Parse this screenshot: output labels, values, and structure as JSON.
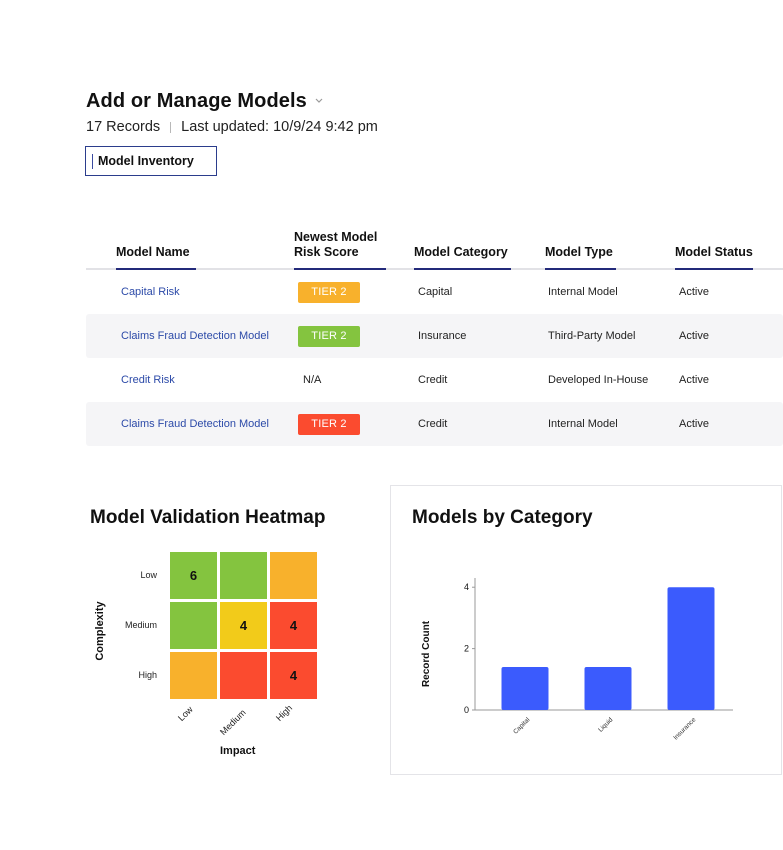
{
  "header": {
    "title": "Add or Manage Models",
    "title_icon": "chevron-down-icon",
    "records": "17 Records",
    "last_updated": "Last updated: 10/9/24 9:42 pm"
  },
  "search": {
    "value": "Model Inventory"
  },
  "table": {
    "columns": [
      {
        "label": "Model Name"
      },
      {
        "label": "Newest Model\nRisk Score"
      },
      {
        "label": "Model Category"
      },
      {
        "label": "Model Type"
      },
      {
        "label": "Model Status"
      }
    ],
    "rows": [
      {
        "name": "Capital Risk",
        "score": "TIER 2",
        "score_color": "#f8b12c",
        "category": "Capital",
        "type": "Internal Model",
        "status": "Active"
      },
      {
        "name": "Claims Fraud Detection Model",
        "score": "TIER 2",
        "score_color": "#84c43f",
        "category": "Insurance",
        "type": "Third-Party Model",
        "status": "Active"
      },
      {
        "name": "Credit Risk",
        "score": "N/A",
        "score_color": null,
        "category": "Credit",
        "type": "Developed In-House",
        "status": "Active"
      },
      {
        "name": "Claims Fraud Detection Model",
        "score": "TIER 2",
        "score_color": "#fb4b2f",
        "category": "Credit",
        "type": "Internal Model",
        "status": "Active"
      }
    ]
  },
  "heatmap": {
    "title": "Model Validation Heatmap",
    "y_axis_title": "Complexity",
    "x_axis_title": "Impact",
    "y_labels": [
      "Low",
      "Medium",
      "High"
    ],
    "x_labels": [
      "Low",
      "Medium",
      "High"
    ],
    "cells": [
      [
        {
          "value": "6",
          "color": "#84c43f"
        },
        {
          "value": "",
          "color": "#84c43f"
        },
        {
          "value": "",
          "color": "#f8b12c"
        }
      ],
      [
        {
          "value": "",
          "color": "#84c43f"
        },
        {
          "value": "4",
          "color": "#f2cb1a"
        },
        {
          "value": "4",
          "color": "#fb4b2f"
        }
      ],
      [
        {
          "value": "",
          "color": "#f8b12c"
        },
        {
          "value": "",
          "color": "#fb4b2f"
        },
        {
          "value": "4",
          "color": "#fb4b2f"
        }
      ]
    ]
  },
  "chart_data": {
    "type": "bar",
    "title": "Models by Category",
    "xlabel": "",
    "ylabel": "Record Count",
    "categories": [
      "Capital",
      "Liquid",
      "Insurance"
    ],
    "values": [
      1.4,
      1.4,
      4
    ],
    "ylim": [
      0,
      4.3
    ],
    "yticks": [
      0,
      2,
      4
    ],
    "bar_color": "#3b5bfd",
    "grid": false
  }
}
